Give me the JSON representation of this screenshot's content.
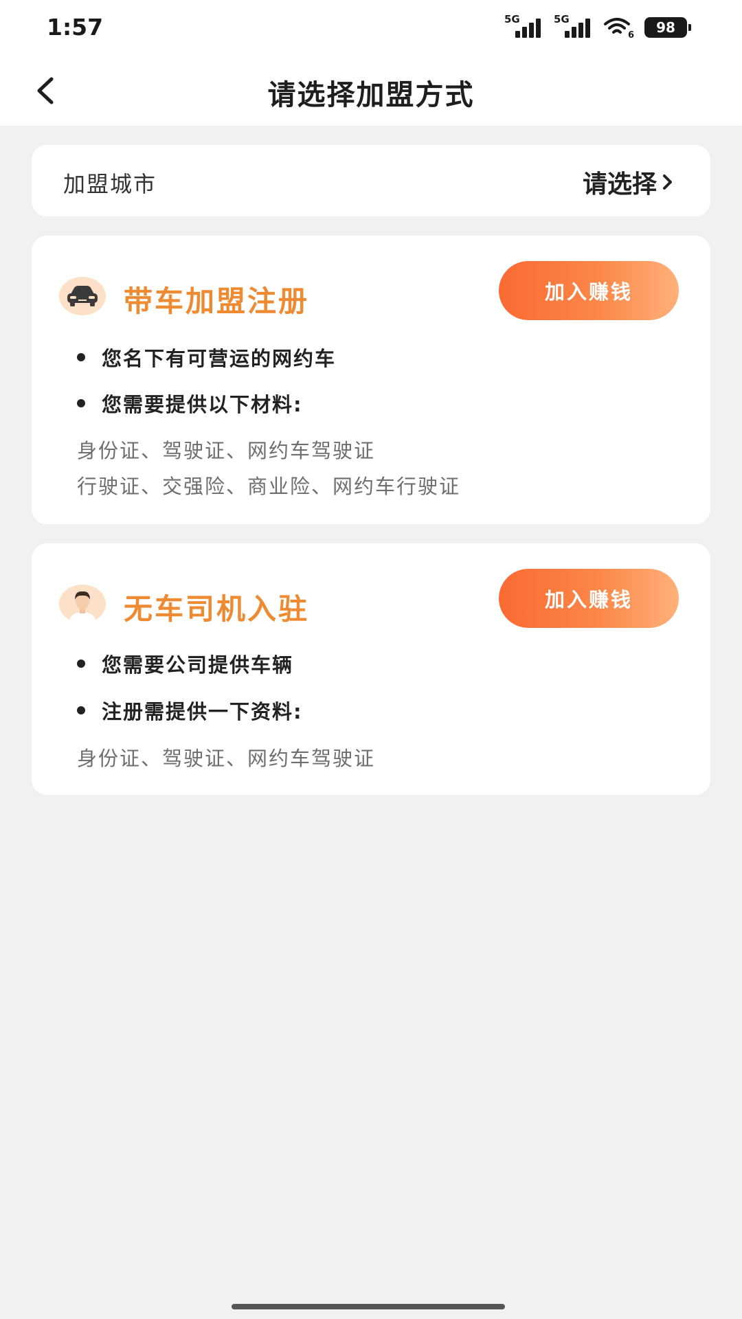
{
  "status_bar": {
    "time": "1:57",
    "signal_1": "5G",
    "signal_2": "5G",
    "wifi_badge": "6",
    "battery": "98"
  },
  "header": {
    "title": "请选择加盟方式"
  },
  "city": {
    "label": "加盟城市",
    "select_label": "请选择"
  },
  "cards": [
    {
      "title": "带车加盟注册",
      "button": "加入赚钱",
      "icon": "car-icon",
      "bullets": [
        "您名下有可营运的网约车",
        "您需要提供以下材料:"
      ],
      "materials": [
        "身份证、驾驶证、网约车驾驶证",
        "行驶证、交强险、商业险、网约车行驶证"
      ]
    },
    {
      "title": "无车司机入驻",
      "button": "加入赚钱",
      "icon": "driver-avatar-icon",
      "bullets": [
        "您需要公司提供车辆",
        "注册需提供一下资料:"
      ],
      "materials": [
        "身份证、驾驶证、网约车驾驶证"
      ]
    }
  ],
  "colors": {
    "accent_title": "#ee8a32",
    "button_start": "#fa6a32",
    "button_end": "#ffb07a",
    "background": "#f1f1f1"
  }
}
